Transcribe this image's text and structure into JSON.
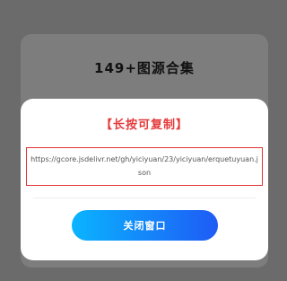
{
  "background": {
    "title": "149+图源合集"
  },
  "modal": {
    "title": "【长按可复制】",
    "url": "https://gcore.jsdelivr.net/gh/yiciyuan/23/yiciyuan/erquetuyuan.json",
    "close_label": "关闭窗口"
  },
  "colors": {
    "overlay": "#6b6b6b",
    "title_red": "#e5393a",
    "button_gradient_start": "#0ab4ff",
    "button_gradient_end": "#1e5bf5"
  }
}
